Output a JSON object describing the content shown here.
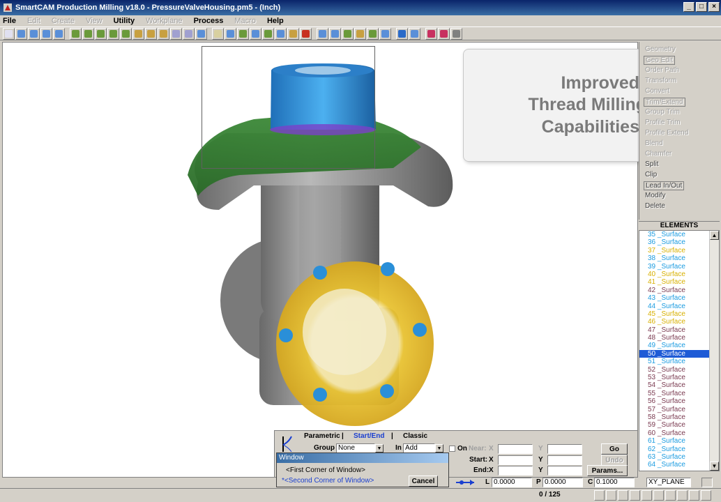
{
  "window": {
    "title": "SmartCAM Production Milling v18.0 - PressureValveHousing.pm5 - (Inch)",
    "minimize": "_",
    "maximize": "□",
    "close": "×"
  },
  "menus": [
    {
      "label": "File",
      "enabled": true
    },
    {
      "label": "Edit",
      "enabled": false
    },
    {
      "label": "Create",
      "enabled": false
    },
    {
      "label": "View",
      "enabled": false
    },
    {
      "label": "Utility",
      "enabled": true
    },
    {
      "label": "Workplane",
      "enabled": false
    },
    {
      "label": "Process",
      "enabled": true
    },
    {
      "label": "Macro",
      "enabled": false
    },
    {
      "label": "Help",
      "enabled": true
    }
  ],
  "overlay": {
    "line1": "Improved",
    "line2": "Thread Milling",
    "line3": "Capabilities"
  },
  "right_menu": [
    {
      "label": "Geometry",
      "enabled": false,
      "boxed": false
    },
    {
      "label": "Geo Edit",
      "enabled": false,
      "boxed": true
    },
    {
      "label": "Order Path",
      "enabled": false,
      "boxed": false
    },
    {
      "label": "Transform",
      "enabled": false,
      "boxed": false
    },
    {
      "label": "Convert",
      "enabled": false,
      "boxed": false
    },
    {
      "label": "Trim/Extend",
      "enabled": false,
      "boxed": true
    },
    {
      "label": "Group Trim",
      "enabled": false,
      "boxed": false
    },
    {
      "label": "Profile Trim",
      "enabled": false,
      "boxed": false
    },
    {
      "label": "Profile Extend",
      "enabled": false,
      "boxed": false
    },
    {
      "label": "Blend",
      "enabled": false,
      "boxed": false
    },
    {
      "label": "Chamfer",
      "enabled": false,
      "boxed": false
    },
    {
      "label": "Split",
      "enabled": true,
      "boxed": false
    },
    {
      "label": "Clip",
      "enabled": true,
      "boxed": false
    },
    {
      "label": "Lead In/Out",
      "enabled": true,
      "boxed": true
    },
    {
      "label": "Modify",
      "enabled": true,
      "boxed": false
    },
    {
      "label": "Delete",
      "enabled": true,
      "boxed": false
    }
  ],
  "elements": {
    "header": "ELEMENTS",
    "items": [
      {
        "label": "35 _Surface",
        "color": "#1a9be0"
      },
      {
        "label": "36 _Surface",
        "color": "#1a9be0"
      },
      {
        "label": "37 _Surface",
        "color": "#d8b000"
      },
      {
        "label": "38 _Surface",
        "color": "#1a9be0"
      },
      {
        "label": "39 _Surface",
        "color": "#1a9be0"
      },
      {
        "label": "40 _Surface",
        "color": "#d8b000"
      },
      {
        "label": "41 _Surface",
        "color": "#d8b000"
      },
      {
        "label": "42 _Surface",
        "color": "#7a3a50"
      },
      {
        "label": "43 _Surface",
        "color": "#1a9be0"
      },
      {
        "label": "44 _Surface",
        "color": "#1a9be0"
      },
      {
        "label": "45 _Surface",
        "color": "#d8b000"
      },
      {
        "label": "46 _Surface",
        "color": "#d8b000"
      },
      {
        "label": "47 _Surface",
        "color": "#7a3a50"
      },
      {
        "label": "48 _Surface",
        "color": "#7a3a50"
      },
      {
        "label": "49 _Surface",
        "color": "#1a9be0"
      },
      {
        "label": "50 _Surface",
        "color": "#1a9be0"
      },
      {
        "label": "51 _Surface",
        "color": "#1a9be0"
      },
      {
        "label": "52 _Surface",
        "color": "#7a3a50"
      },
      {
        "label": "53 _Surface",
        "color": "#7a3a50"
      },
      {
        "label": "54 _Surface",
        "color": "#7a3a50"
      },
      {
        "label": "55 _Surface",
        "color": "#7a3a50"
      },
      {
        "label": "56 _Surface",
        "color": "#7a3a50"
      },
      {
        "label": "57 _Surface",
        "color": "#7a3a50"
      },
      {
        "label": "58 _Surface",
        "color": "#7a3a50"
      },
      {
        "label": "59 _Surface",
        "color": "#7a3a50"
      },
      {
        "label": "60 _Surface",
        "color": "#7a3a50"
      },
      {
        "label": "61 _Surface",
        "color": "#1a9be0"
      },
      {
        "label": "62 _Surface",
        "color": "#1a9be0"
      },
      {
        "label": "63 _Surface",
        "color": "#1a9be0"
      },
      {
        "label": "64 _Surface",
        "color": "#1a9be0"
      }
    ],
    "selected_index": 15,
    "scroll_up": "▲",
    "scroll_down": "▼"
  },
  "command_panel": {
    "tabs": [
      "Parametric",
      "Start/End",
      "Classic"
    ],
    "tab_separator": "|",
    "group_label": "Group",
    "group_value": "None",
    "in_label": "In",
    "in_value": "Add",
    "on_label": "On",
    "near_label": "Near:",
    "start_label": "Start:",
    "end_label": "End:",
    "x_label": "X",
    "y_label": "Y",
    "go": "Go",
    "undo": "Undo",
    "params": "Params...",
    "dd_arrow": "▼"
  },
  "window_dialog": {
    "title": "Window",
    "first": "<First Corner of Window>",
    "second": "<Second Corner of Window>",
    "second_marker": "*",
    "cancel": "Cancel"
  },
  "status": {
    "l_label": "L",
    "l_value": "0.0000",
    "p_label": "P",
    "p_value": "0.0000",
    "c_label": "C",
    "c_value": "0.1000",
    "plane": "XY_PLANE",
    "count": "0 / 125"
  },
  "colors": {
    "accent": "#0a246a",
    "model_blue": "#2a8fd8",
    "model_green": "#3f8f3a",
    "model_yellow": "#e8c232",
    "model_gray": "#8a8a8a"
  }
}
